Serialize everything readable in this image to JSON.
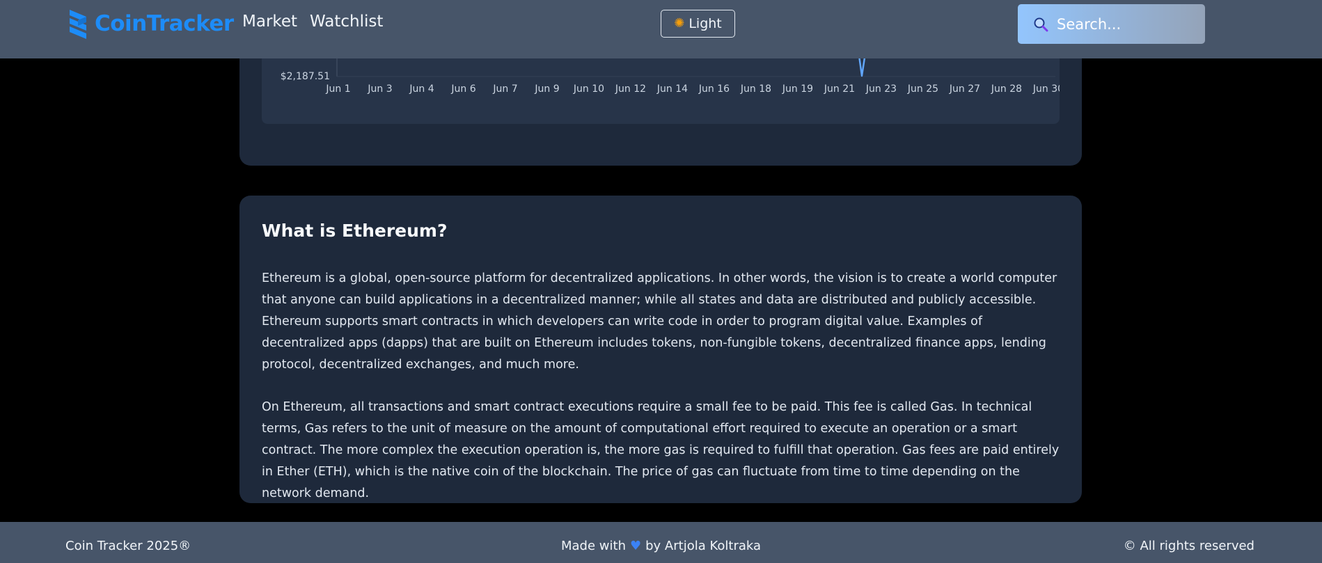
{
  "navbar": {
    "logo_text": "CoinTracker",
    "links": [
      {
        "label": "Market"
      },
      {
        "label": "Watchlist"
      }
    ],
    "theme_button": {
      "label": "Light",
      "icon": "sun-icon"
    },
    "search": {
      "placeholder": "Search...",
      "icon": "search-icon"
    }
  },
  "chart_data": {
    "type": "line",
    "title": "",
    "xlabel": "",
    "ylabel": "",
    "y_tick_labels": [
      "$2,187.51"
    ],
    "categories": [
      "Jun 1",
      "Jun 3",
      "Jun 4",
      "Jun 6",
      "Jun 7",
      "Jun 9",
      "Jun 10",
      "Jun 12",
      "Jun 14",
      "Jun 16",
      "Jun 18",
      "Jun 19",
      "Jun 21",
      "Jun 23",
      "Jun 25",
      "Jun 27",
      "Jun 28",
      "Jun 30"
    ],
    "visible_segment": {
      "x": [
        "Jun 21",
        "Jun 22",
        "Jun 23"
      ],
      "note_values_near_axis_min": true
    },
    "y_min_label_value": 2187.51,
    "line_color": "#60a5fa"
  },
  "about": {
    "title": "What is Ethereum?",
    "paragraphs": [
      "Ethereum is a global, open-source platform for decentralized applications. In other words, the vision is to create a world computer that anyone can build applications in a decentralized manner; while all states and data are distributed and publicly accessible. Ethereum supports smart contracts in which developers can write code in order to program digital value. Examples of decentralized apps (dapps) that are built on Ethereum includes tokens, non-fungible tokens, decentralized finance apps, lending protocol, decentralized exchanges, and much more.",
      "On Ethereum, all transactions and smart contract executions require a small fee to be paid. This fee is called Gas. In technical terms, Gas refers to the unit of measure on the amount of computational effort required to execute an operation or a smart contract. The more complex the execution operation is, the more gas is required to fulfill that operation. Gas fees are paid entirely in Ether (ETH), which is the native coin of the blockchain. The price of gas can fluctuate from time to time depending on the network demand."
    ]
  },
  "footer": {
    "left": "Coin Tracker 2025®",
    "center_prefix": "Made with",
    "center_icon": "heart-icon",
    "center_suffix": "by Artjola Koltraka",
    "right": "© All rights reserved"
  },
  "colors": {
    "navbar_bg": "#475569",
    "card_bg": "#1e293b",
    "logo": "#1d8cf8",
    "accent_line": "#60a5fa"
  }
}
